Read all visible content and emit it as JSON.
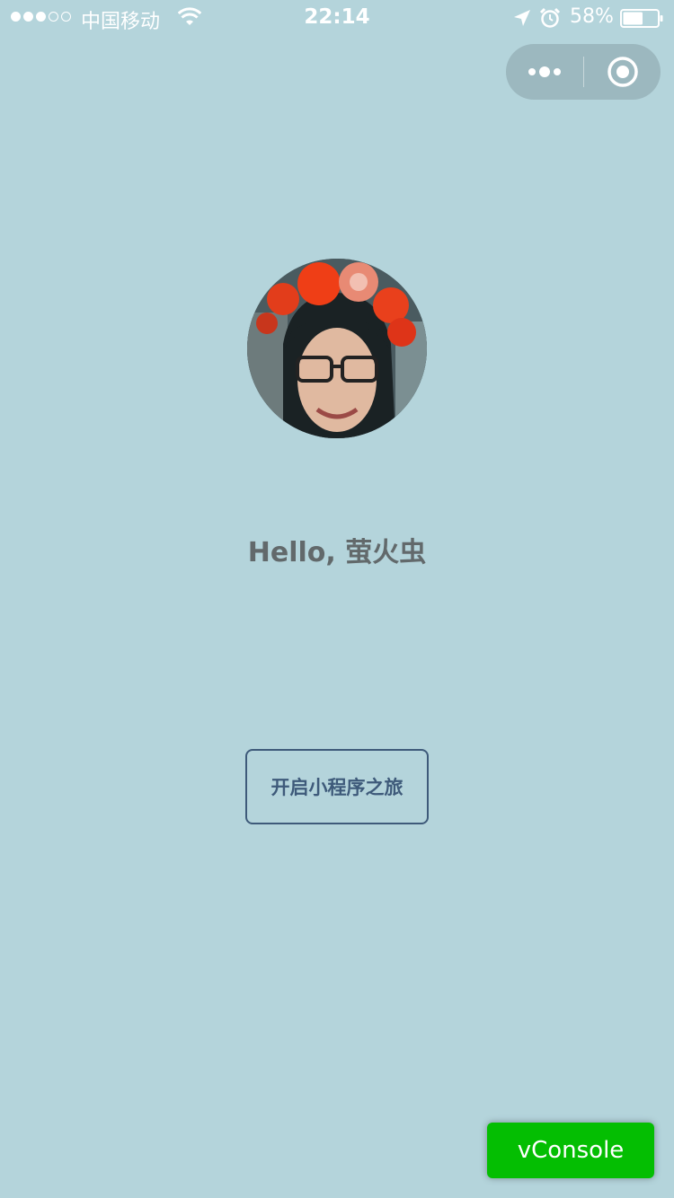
{
  "status_bar": {
    "carrier": "中国移动",
    "time": "22:14",
    "battery_percent": "58%",
    "battery_level": 0.58,
    "signal_filled": 3,
    "signal_total": 5,
    "icons": [
      "wifi-icon",
      "location-icon",
      "alarm-icon",
      "battery-icon"
    ]
  },
  "capsule": {
    "more_icon": "more-dots-icon",
    "close_icon": "close-target-icon"
  },
  "profile": {
    "avatar_icon": "avatar",
    "greeting": "Hello, 萤火虫"
  },
  "actions": {
    "start_label": "开启小程序之旅",
    "vconsole_label": "vConsole"
  },
  "colors": {
    "background": "#b4d4db",
    "button_border": "#3e5a7a",
    "vconsole_green": "#04be02",
    "greeting_text": "#62696b"
  }
}
